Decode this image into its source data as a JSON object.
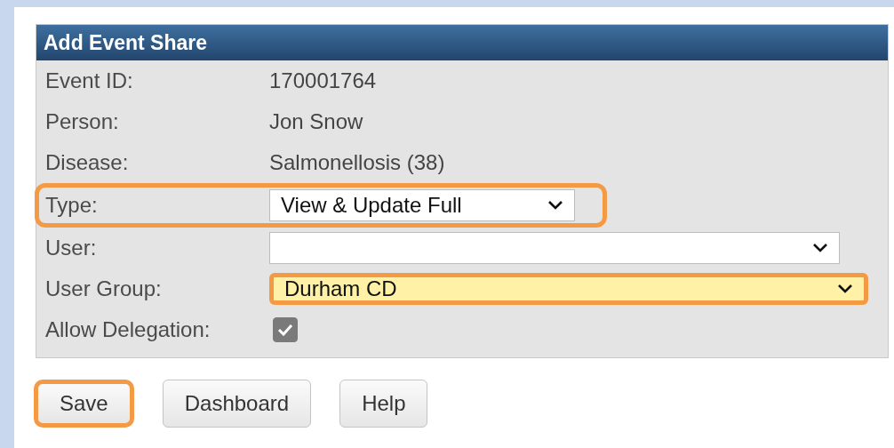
{
  "panel": {
    "title": "Add Event Share",
    "rows": [
      {
        "kind": "text",
        "label": "Event ID:",
        "value": "170001764"
      },
      {
        "kind": "text",
        "label": "Person:",
        "value": "Jon Snow"
      },
      {
        "kind": "text",
        "label": "Disease:",
        "value": "Salmonellosis (38)"
      },
      {
        "kind": "short-select",
        "label": "Type:",
        "value": "View & Update Full",
        "row_highlighted": true,
        "field_highlighted": false,
        "focused": false
      },
      {
        "kind": "select",
        "label": "User:",
        "focused": false
      },
      {
        "kind": "select",
        "label": "User Group:",
        "value": "Durham CD",
        "row_highlighted": false,
        "field_highlighted": true,
        "focused": true
      },
      {
        "kind": "checkbox",
        "label": "Allow Delegation:",
        "checked": true
      }
    ]
  },
  "buttons": [
    {
      "label": "Save",
      "highlighted": true
    },
    {
      "label": "Dashboard",
      "highlighted": false
    },
    {
      "label": "Help",
      "highlighted": false
    }
  ]
}
